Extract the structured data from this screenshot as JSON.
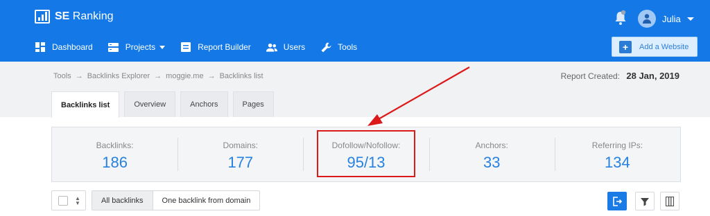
{
  "brand": {
    "name_bold": "SE",
    "name_rest": " Ranking"
  },
  "user": {
    "name": "Julia"
  },
  "nav": [
    {
      "label": "Dashboard",
      "icon": "dashboard-icon"
    },
    {
      "label": "Projects",
      "icon": "projects-icon",
      "dropdown": true
    },
    {
      "label": "Report Builder",
      "icon": "report-builder-icon"
    },
    {
      "label": "Users",
      "icon": "users-icon"
    },
    {
      "label": "Tools",
      "icon": "tools-icon"
    }
  ],
  "add_website": {
    "label": "Add a Website"
  },
  "breadcrumb": [
    "Tools",
    "→",
    "Backlinks Explorer",
    "→",
    "moggie.me",
    "→",
    "Backlinks list"
  ],
  "report": {
    "label": "Report Created:",
    "date": "28 Jan, 2019"
  },
  "tabs": [
    {
      "label": "Backlinks list",
      "active": true
    },
    {
      "label": "Overview"
    },
    {
      "label": "Anchors"
    },
    {
      "label": "Pages"
    }
  ],
  "stats": [
    {
      "label": "Backlinks:",
      "value": "186"
    },
    {
      "label": "Domains:",
      "value": "177"
    },
    {
      "label": "Dofollow/Nofollow:",
      "value": "95/13"
    },
    {
      "label": "Anchors:",
      "value": "33"
    },
    {
      "label": "Referring IPs:",
      "value": "134"
    }
  ],
  "filters": {
    "all": "All backlinks",
    "one": "One backlink from domain"
  },
  "colors": {
    "header": "#1479e6",
    "accent": "#2681e0",
    "highlight": "#dd1a1a"
  }
}
